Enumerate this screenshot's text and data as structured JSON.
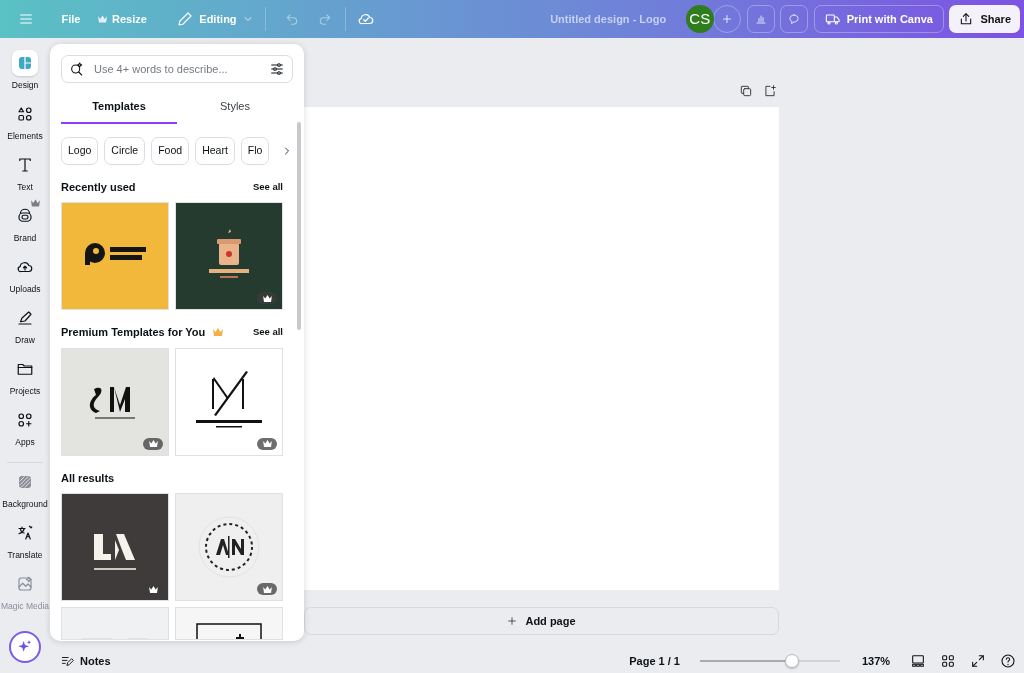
{
  "topbar": {
    "file": "File",
    "resize": "Resize",
    "editing": "Editing",
    "title": "Untitled design - Logo",
    "avatar": "CS",
    "print": "Print with Canva",
    "share": "Share"
  },
  "sidebar": {
    "items": [
      {
        "label": "Design",
        "selected": true,
        "premium": false,
        "disabled": false
      },
      {
        "label": "Elements",
        "selected": false,
        "premium": false,
        "disabled": false
      },
      {
        "label": "Text",
        "selected": false,
        "premium": false,
        "disabled": false
      },
      {
        "label": "Brand",
        "selected": false,
        "premium": true,
        "disabled": false
      },
      {
        "label": "Uploads",
        "selected": false,
        "premium": false,
        "disabled": false
      },
      {
        "label": "Draw",
        "selected": false,
        "premium": false,
        "disabled": false
      },
      {
        "label": "Projects",
        "selected": false,
        "premium": false,
        "disabled": false
      },
      {
        "label": "Apps",
        "selected": false,
        "premium": false,
        "disabled": false
      },
      {
        "label": "Background",
        "selected": false,
        "premium": false,
        "disabled": false
      },
      {
        "label": "Translate",
        "selected": false,
        "premium": false,
        "disabled": false
      },
      {
        "label": "Magic Media",
        "selected": false,
        "premium": false,
        "disabled": true
      }
    ]
  },
  "panel": {
    "search": {
      "placeholder": "Use 4+ words to describe..."
    },
    "tabs": [
      {
        "label": "Templates",
        "selected": true
      },
      {
        "label": "Styles",
        "selected": false
      }
    ],
    "chips": [
      "Logo",
      "Circle",
      "Food",
      "Heart",
      "Flo"
    ],
    "sections": [
      {
        "title": "Recently used",
        "premium": false,
        "see_all": "See all",
        "thumbnails": [
          {
            "kind": "picture",
            "premium": false
          },
          {
            "kind": "picture",
            "premium": true
          }
        ]
      },
      {
        "title": "Premium Templates for You",
        "premium": true,
        "see_all": "See all",
        "thumbnails": [
          {
            "kind": "picture",
            "premium": true
          },
          {
            "kind": "picture",
            "premium": true
          }
        ]
      },
      {
        "title": "All results",
        "premium": false,
        "thumbnails": [
          {
            "kind": "picture",
            "premium": true
          },
          {
            "kind": "picture",
            "premium": true
          },
          {
            "kind": "picture",
            "premium": false
          },
          {
            "kind": "picture",
            "premium": false
          }
        ]
      }
    ]
  },
  "canvas": {
    "add_page": "Add page"
  },
  "footer": {
    "notes": "Notes",
    "page": "Page 1 / 1",
    "zoom": {
      "level": 0.66
    },
    "zoom_reading": "137%"
  }
}
